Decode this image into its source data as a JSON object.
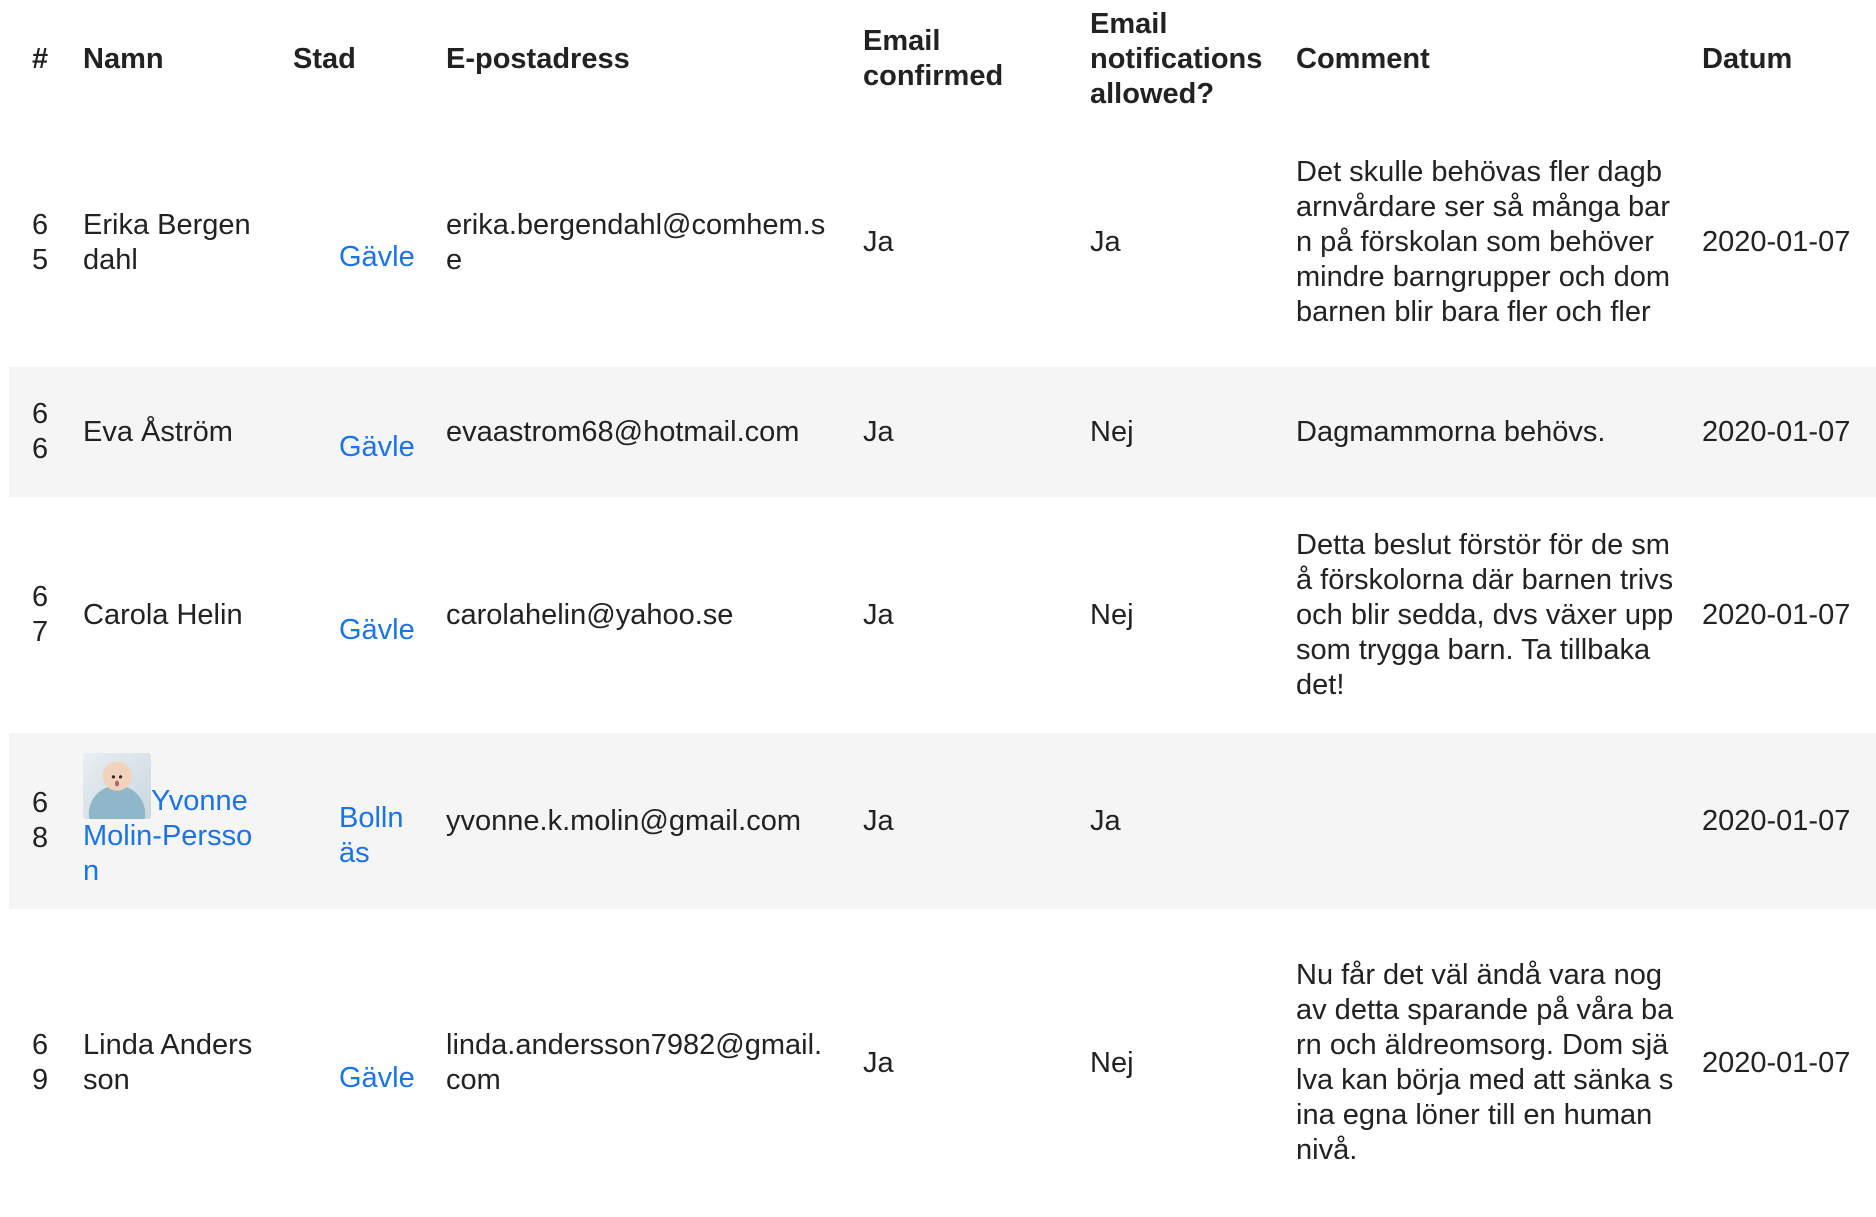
{
  "table": {
    "headers": {
      "num": "#",
      "name": "Namn",
      "city": "Stad",
      "email": "E-postadress",
      "confirmed": "Email confirmed",
      "notifications": "Email notifications allowed?",
      "comment": "Comment",
      "date": "Datum"
    },
    "rows": [
      {
        "num": "65",
        "name": "Erika Bergendahl",
        "city": "Gävle",
        "email": "erika.bergendahl@comhem.se",
        "confirmed": "Ja",
        "notifications": "Ja",
        "comment": "Det skulle behövas fler dagbarnvårdare ser så många barn på förskolan som behöver mindre barngrupper och dom barnen blir bara fler och fler",
        "date": "2020-01-07"
      },
      {
        "num": "66",
        "name": "Eva Åström",
        "city": "Gävle",
        "email": "evaastrom68@hotmail.com",
        "confirmed": "Ja",
        "notifications": "Nej",
        "comment": "Dagmammorna behövs.",
        "date": "2020-01-07"
      },
      {
        "num": "67",
        "name": "Carola Helin",
        "city": "Gävle",
        "email": "carolahelin@yahoo.se",
        "confirmed": "Ja",
        "notifications": "Nej",
        "comment": "Detta beslut förstör för de små förskolorna där barnen trivs och blir sedda, dvs växer upp som trygga barn. Ta tillbaka det!",
        "date": "2020-01-07"
      },
      {
        "num": "68",
        "name": "Yvonne Molin-Persson",
        "city": "Bollnäs",
        "email": "yvonne.k.molin@gmail.com",
        "confirmed": "Ja",
        "notifications": "Ja",
        "comment": "",
        "date": "2020-01-07"
      },
      {
        "num": "69",
        "name": "Linda Andersson",
        "city": "Gävle",
        "email": "linda.andersson7982@gmail.com",
        "confirmed": "Ja",
        "notifications": "Nej",
        "comment": "Nu får det väl ändå vara nog av detta sparande på våra barn och äldreomsorg. Dom själva kan börja med att sänka sina egna löner till en human nivå.",
        "date": "2020-01-07"
      }
    ]
  },
  "colors": {
    "link": "#1a73e8",
    "shaded_row": "#f5f5f5",
    "text": "#222222"
  },
  "icons": {
    "avatar": "profile-photo-avatar"
  }
}
